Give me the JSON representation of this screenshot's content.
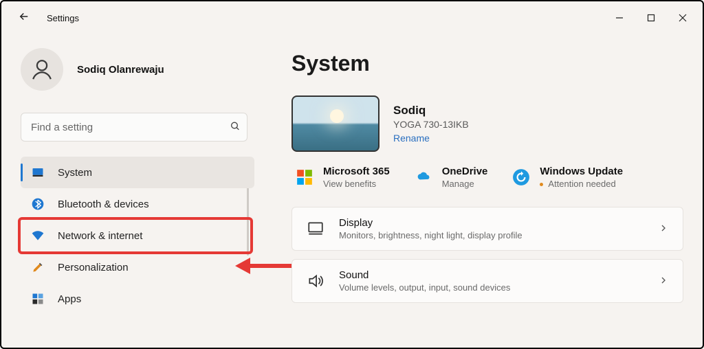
{
  "window": {
    "app_title": "Settings"
  },
  "user": {
    "name": "Sodiq Olanrewaju"
  },
  "search": {
    "placeholder": "Find a setting"
  },
  "sidebar": {
    "items": [
      {
        "label": "System"
      },
      {
        "label": "Bluetooth & devices"
      },
      {
        "label": "Network & internet"
      },
      {
        "label": "Personalization"
      },
      {
        "label": "Apps"
      }
    ]
  },
  "main": {
    "heading": "System",
    "device": {
      "name": "Sodiq",
      "model": "YOGA 730-13IKB",
      "rename": "Rename"
    },
    "tiles": {
      "m365": {
        "title": "Microsoft 365",
        "sub": "View benefits"
      },
      "onedrive": {
        "title": "OneDrive",
        "sub": "Manage"
      },
      "update": {
        "title": "Windows Update",
        "sub": "Attention needed"
      }
    },
    "cards": {
      "display": {
        "title": "Display",
        "sub": "Monitors, brightness, night light, display profile"
      },
      "sound": {
        "title": "Sound",
        "sub": "Volume levels, output, input, sound devices"
      }
    }
  }
}
